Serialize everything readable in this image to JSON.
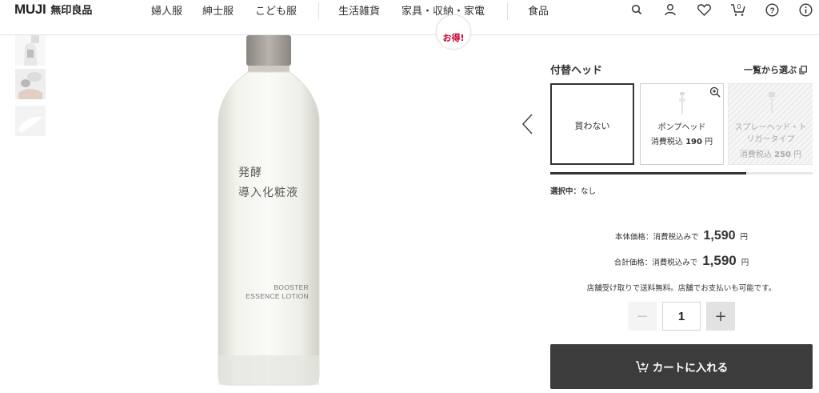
{
  "header": {
    "logo_en": "MUJI",
    "logo_jp": "無印良品",
    "nav": [
      "婦人服",
      "紳士服",
      "こども服",
      "生活雑貨",
      "家具・収納・家電",
      "食品"
    ],
    "icons": [
      "search-icon",
      "account-icon",
      "favorite-icon",
      "cart-icon",
      "help-icon",
      "info-icon"
    ],
    "cart_count": "0"
  },
  "product": {
    "badge": "お得!",
    "bottle_jp": [
      "発酵",
      "導入化粧液"
    ],
    "bottle_en": [
      "BOOSTER",
      "ESSENCE LOTION"
    ]
  },
  "options": {
    "title": "付替ヘッド",
    "list_link": "一覧から選ぶ",
    "items": [
      {
        "name": "買わない",
        "price_prefix": "",
        "price": "",
        "unit": ""
      },
      {
        "name": "ポンプヘッド",
        "price_prefix": "消費税込 ",
        "price": "190",
        "unit": " 円"
      },
      {
        "name": "スプレーヘッド・トリガータイプ",
        "name_line1": "スプレーヘッド・ト",
        "name_line2": "リガータイプ",
        "price_prefix": "消費税込 ",
        "price": "250",
        "unit": " 円"
      }
    ],
    "selection_label": "選択中：",
    "selection_value": "なし"
  },
  "pricing": {
    "base_label": "本体価格：消費税込みで",
    "base_value": "1,590",
    "total_label": "合計価格：消費税込みで",
    "total_value": "1,590",
    "yen": "円",
    "note": "店舗受け取りで送料無料。店舗でお支払いも可能です。"
  },
  "quantity": {
    "value": "1",
    "minus": "−",
    "plus": "+"
  },
  "cart": {
    "label": "カートに入れる"
  },
  "colors": {
    "dark": "#3c3c3c",
    "accent": "#c6002b"
  }
}
